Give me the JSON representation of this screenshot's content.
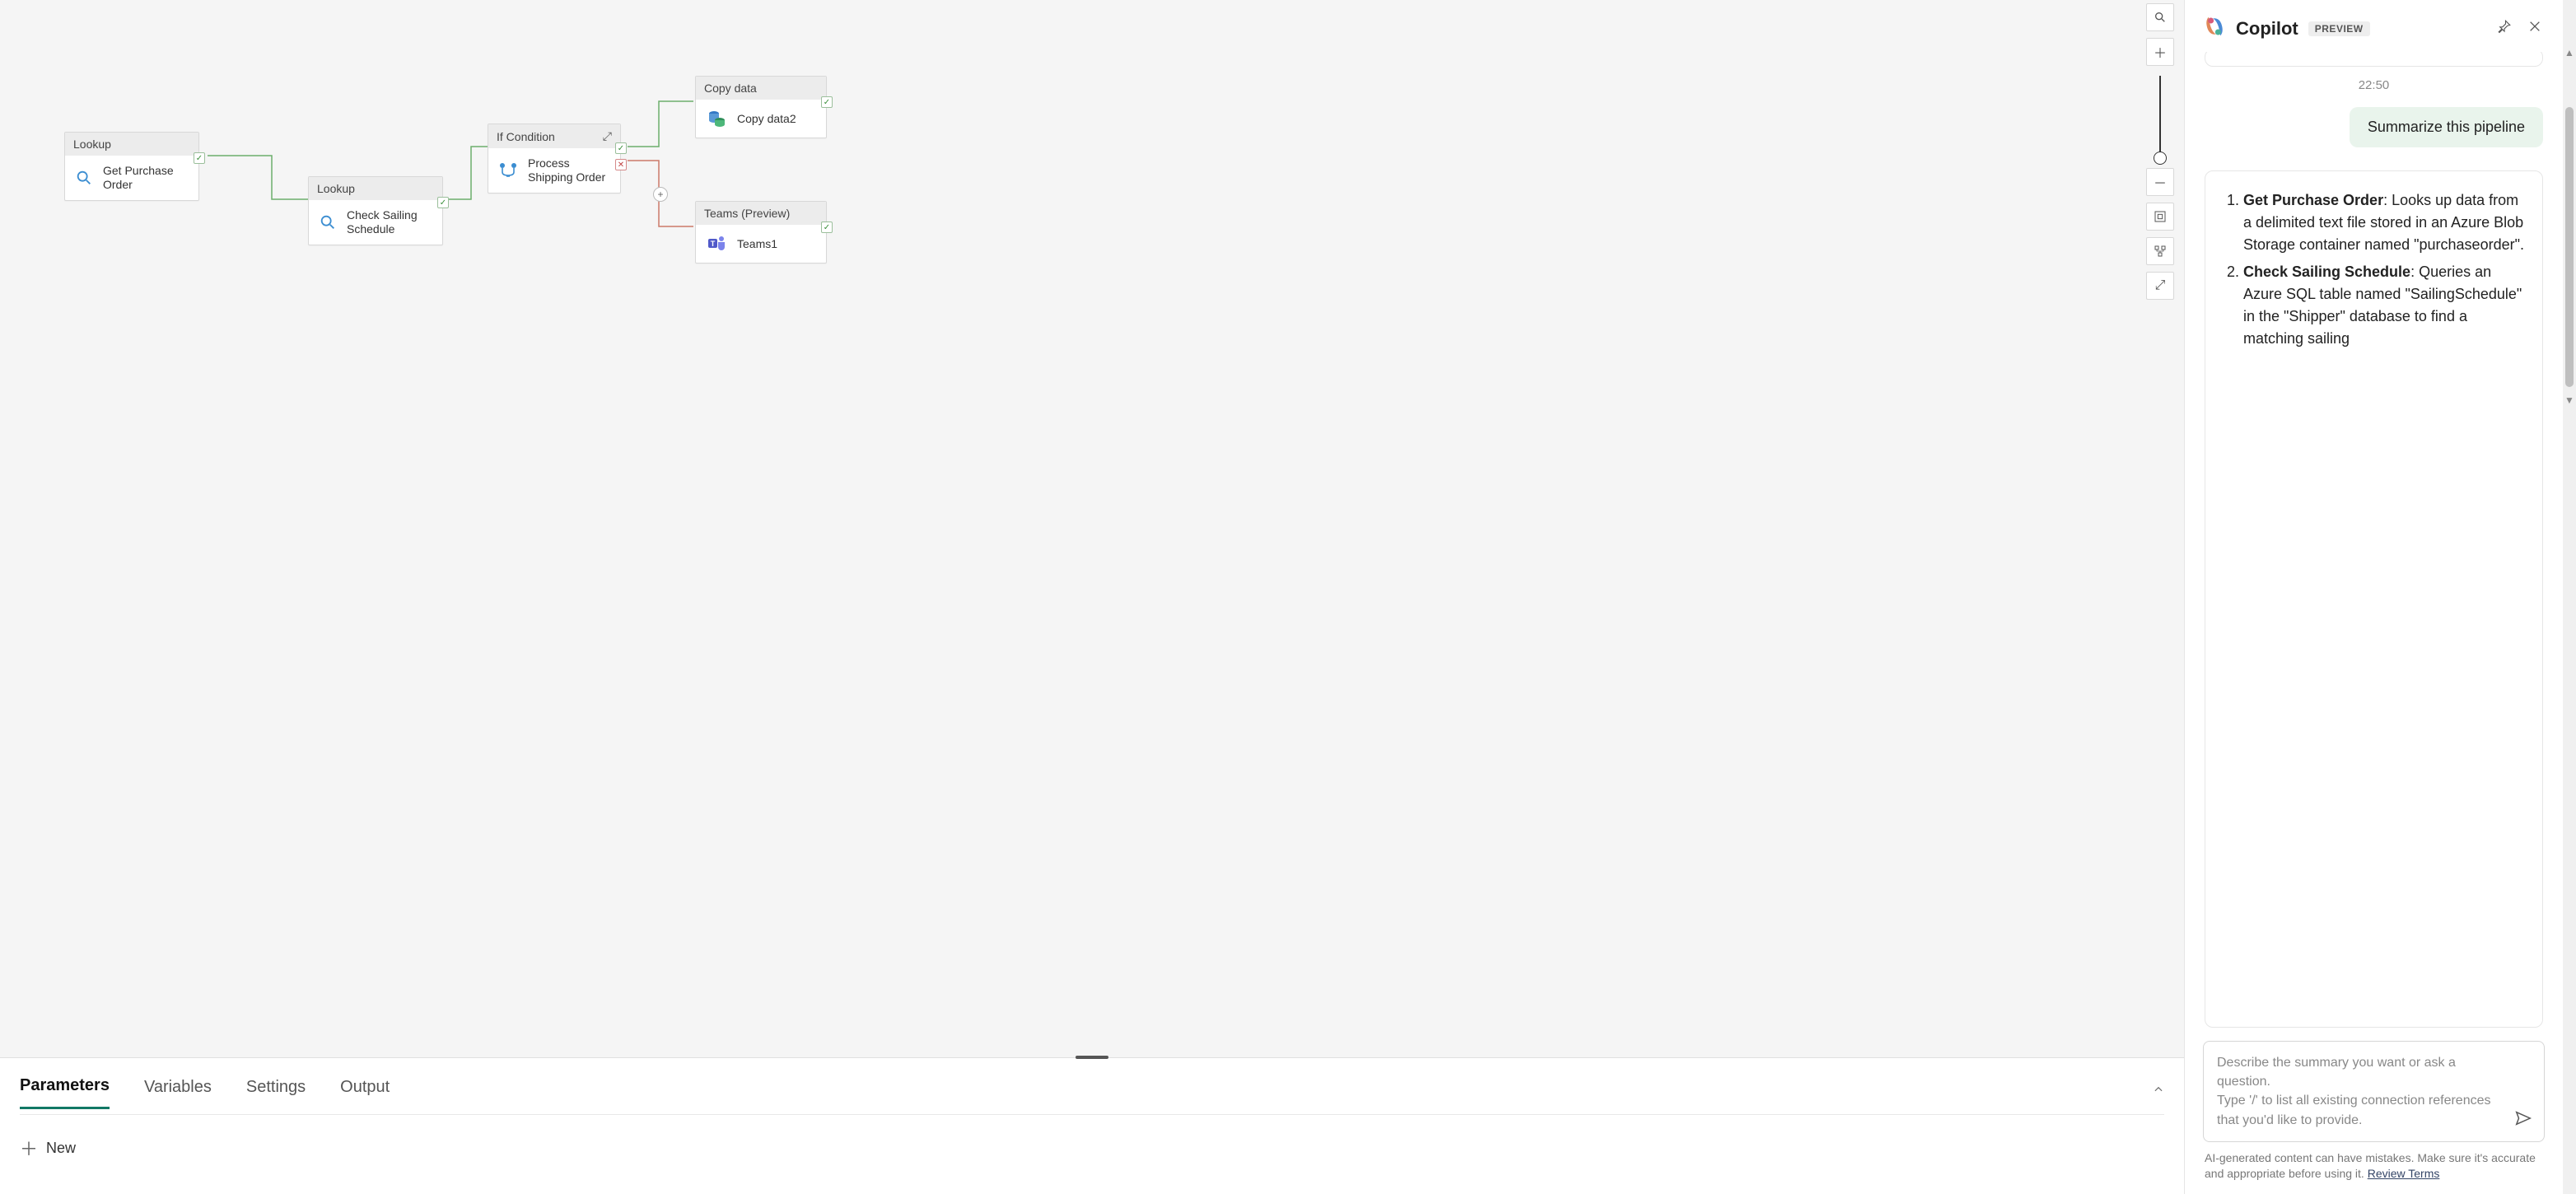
{
  "canvas": {
    "nodes": {
      "get_po": {
        "type": "Lookup",
        "label": "Get Purchase Order"
      },
      "check_sail": {
        "type": "Lookup",
        "label": "Check Sailing Schedule"
      },
      "if_cond": {
        "type": "If Condition",
        "label": "Process Shipping Order"
      },
      "copy_data": {
        "type": "Copy data",
        "label": "Copy data2"
      },
      "teams": {
        "type": "Teams (Preview)",
        "label": "Teams1"
      }
    },
    "tools": {
      "search": "search-icon",
      "zoom_in": "zoom-in",
      "zoom_out": "zoom-out",
      "fit": "fit-to-screen",
      "layout": "auto-layout",
      "fullscreen": "fullscreen"
    }
  },
  "bottom": {
    "tabs": [
      "Parameters",
      "Variables",
      "Settings",
      "Output"
    ],
    "active_tab": "Parameters",
    "new_label": "New"
  },
  "copilot": {
    "title": "Copilot",
    "badge": "PREVIEW",
    "timestamp": "22:50",
    "user_message": "Summarize this pipeline",
    "assistant_items": [
      {
        "title": "Get Purchase Order",
        "text": ": Looks up data from a delimited text file stored in an Azure Blob Storage container named \"purchaseorder\"."
      },
      {
        "title": "Check Sailing Schedule",
        "text": ": Queries an Azure SQL table named \"SailingSchedule\" in the \"Shipper\" database to find a matching sailing"
      }
    ],
    "input_placeholder": "Describe the summary you want or ask a question.\nType '/' to list all existing connection references that you'd like to provide.",
    "disclaimer_text": "AI-generated content can have mistakes. Make sure it's accurate and appropriate before using it. ",
    "disclaimer_link": "Review Terms"
  }
}
